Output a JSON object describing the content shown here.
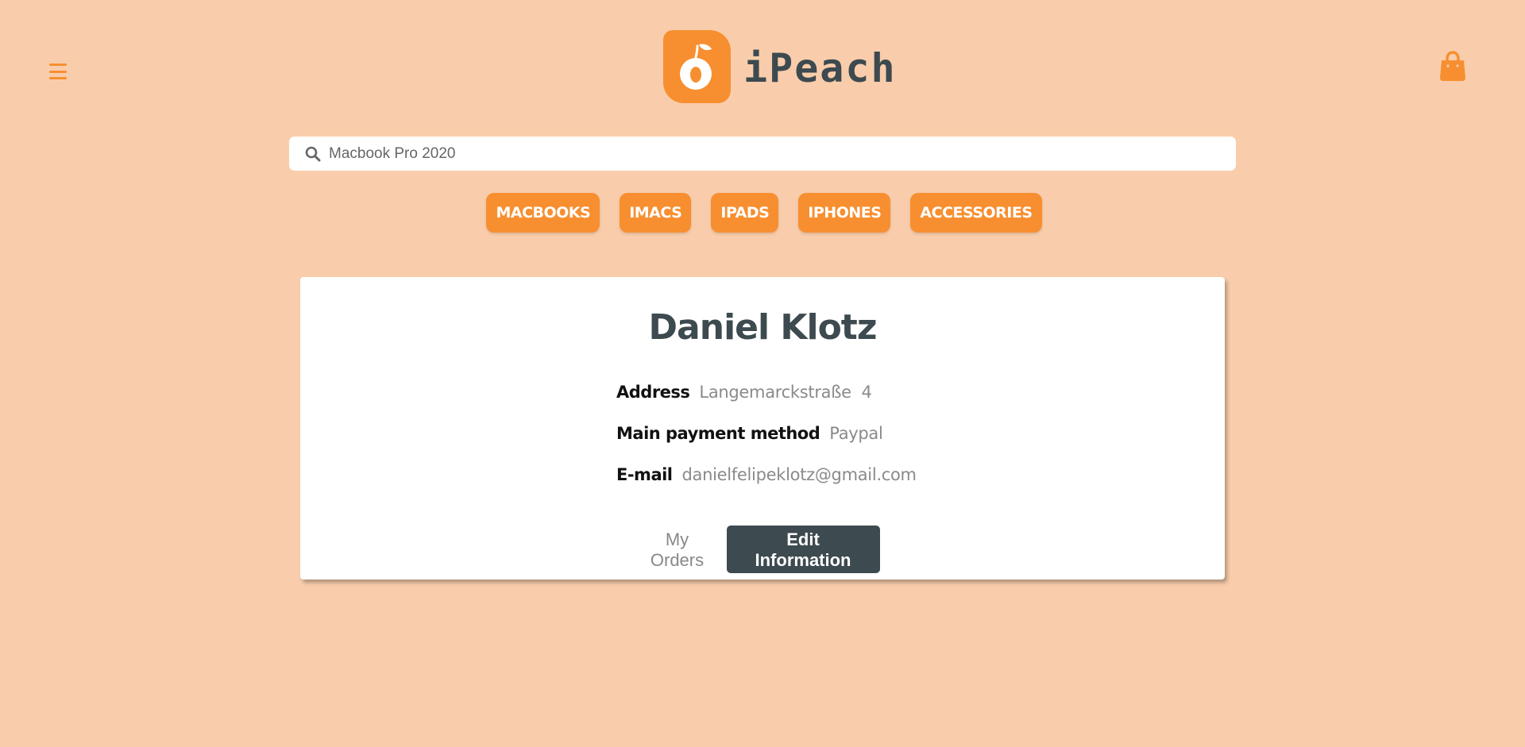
{
  "header": {
    "brand": "iPeach",
    "menu_icon": "hamburger-menu-icon",
    "cart_icon": "shopping-bag-icon",
    "accent_color": "#f78f30",
    "dark_color": "#3d4a4f",
    "background_color": "#f9cdab"
  },
  "search": {
    "icon": "search-icon",
    "placeholder": "Macbook Pro 2020"
  },
  "categories": [
    "MACBOOKS",
    "IMACS",
    "IPADS",
    "IPHONES",
    "ACCESSORIES"
  ],
  "profile": {
    "name": "Daniel Klotz",
    "fields": [
      {
        "label": "Address",
        "value": "Langemarckstraße  4"
      },
      {
        "label": "Main payment method",
        "value": "Paypal"
      },
      {
        "label": "E-mail",
        "value": "danielfelipeklotz@gmail.com"
      }
    ],
    "orders_button_line1": "My",
    "orders_button_line2": "Orders",
    "edit_button_line1": "Edit",
    "edit_button_line2": "Information"
  }
}
